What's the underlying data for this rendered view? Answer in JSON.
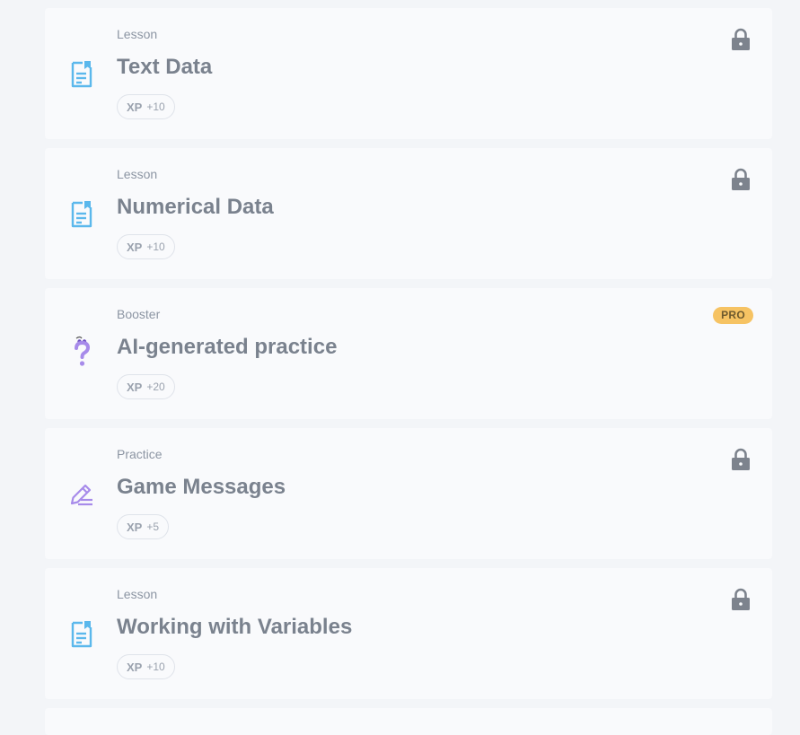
{
  "cards": [
    {
      "type": "Lesson",
      "title": "Text Data",
      "xp_label": "XP",
      "xp_value": "+10",
      "icon": "lesson-doc-icon",
      "status": "locked"
    },
    {
      "type": "Lesson",
      "title": "Numerical Data",
      "xp_label": "XP",
      "xp_value": "+10",
      "icon": "lesson-doc-icon",
      "status": "locked"
    },
    {
      "type": "Booster",
      "title": "AI-generated practice",
      "xp_label": "XP",
      "xp_value": "+20",
      "icon": "question-icon",
      "status": "pro",
      "badge": "PRO"
    },
    {
      "type": "Practice",
      "title": "Game Messages",
      "xp_label": "XP",
      "xp_value": "+5",
      "icon": "pencil-icon",
      "status": "locked"
    },
    {
      "type": "Lesson",
      "title": "Working with Variables",
      "xp_label": "XP",
      "xp_value": "+10",
      "icon": "lesson-doc-icon",
      "status": "locked"
    }
  ],
  "colors": {
    "background": "#f3f5f8",
    "card": "#f9fafc",
    "lesson_icon": "#5bb8ec",
    "practice_icon": "#a78bea",
    "lock": "#7d838d",
    "pro_badge": "#f6c363"
  }
}
